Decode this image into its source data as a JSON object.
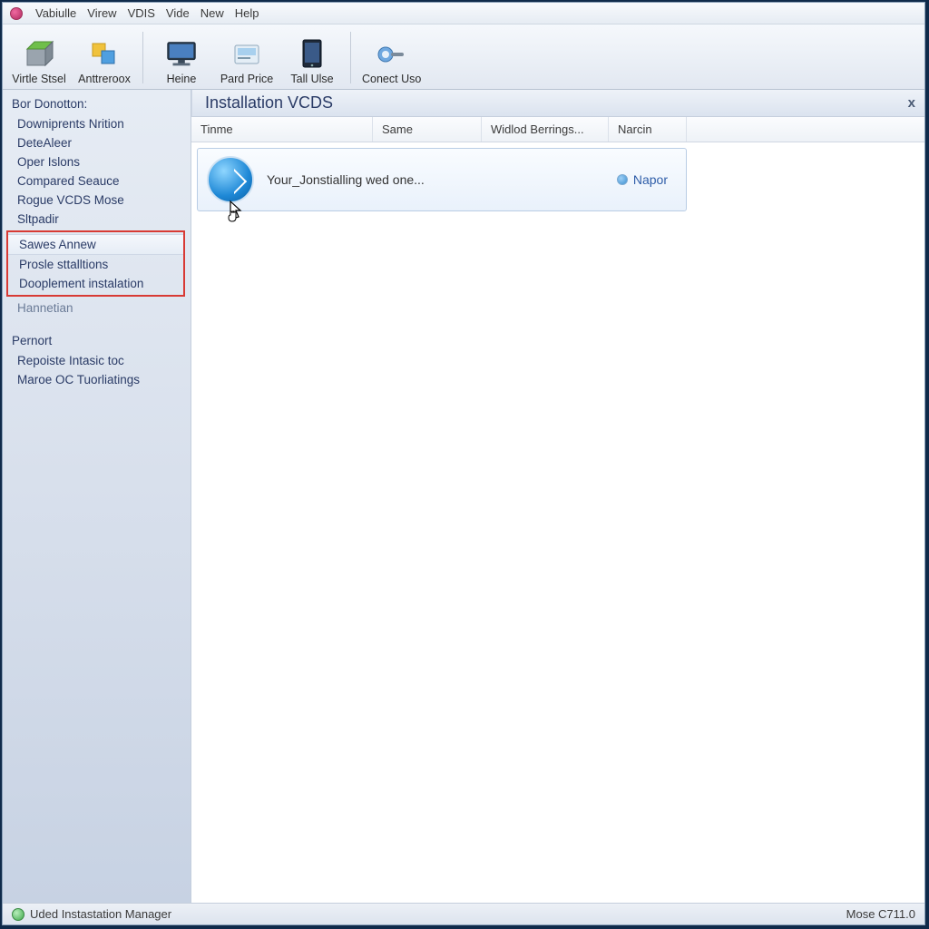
{
  "menubar": {
    "items": [
      "Vabiulle",
      "Virew",
      "VDIS",
      "Vide",
      "New",
      "Help"
    ]
  },
  "toolbar": {
    "buttons": [
      {
        "label": "Virtle Stsel",
        "icon": "box-green-icon"
      },
      {
        "label": "Anttreroox",
        "icon": "squares-icon"
      },
      {
        "label": "Heine",
        "icon": "monitor-icon"
      },
      {
        "label": "Pard Price",
        "icon": "card-icon"
      },
      {
        "label": "Tall Ulse",
        "icon": "tablet-icon"
      },
      {
        "label": "Conect Uso",
        "icon": "connect-icon"
      }
    ]
  },
  "sidebar": {
    "section1_title": "Bor Donotton:",
    "section1_items": [
      "Downiprents Nrition",
      "DeteAleer",
      "Oper Islons",
      "Compared Seauce",
      "Rogue VCDS Mose",
      "Sltpadir"
    ],
    "highlighted": [
      "Sawes Annew",
      "Prosle sttalltions",
      "Dooplement instalation"
    ],
    "after_highlight": "Hannetian",
    "section2_title": "Pernort",
    "section2_items": [
      "Repoiste Intasic toc",
      "Maroe OC Tuorliatings"
    ]
  },
  "panel": {
    "title": "Installation VCDS",
    "close": "x",
    "columns": [
      "Tinme",
      "Same",
      "Widlod Berrings...",
      "Narcin"
    ],
    "row": {
      "primary": "Your_Jonstialling wed one...",
      "status": "Napor"
    }
  },
  "statusbar": {
    "left": "Uded Instastation  Manager",
    "right": "Mose C711.0"
  }
}
